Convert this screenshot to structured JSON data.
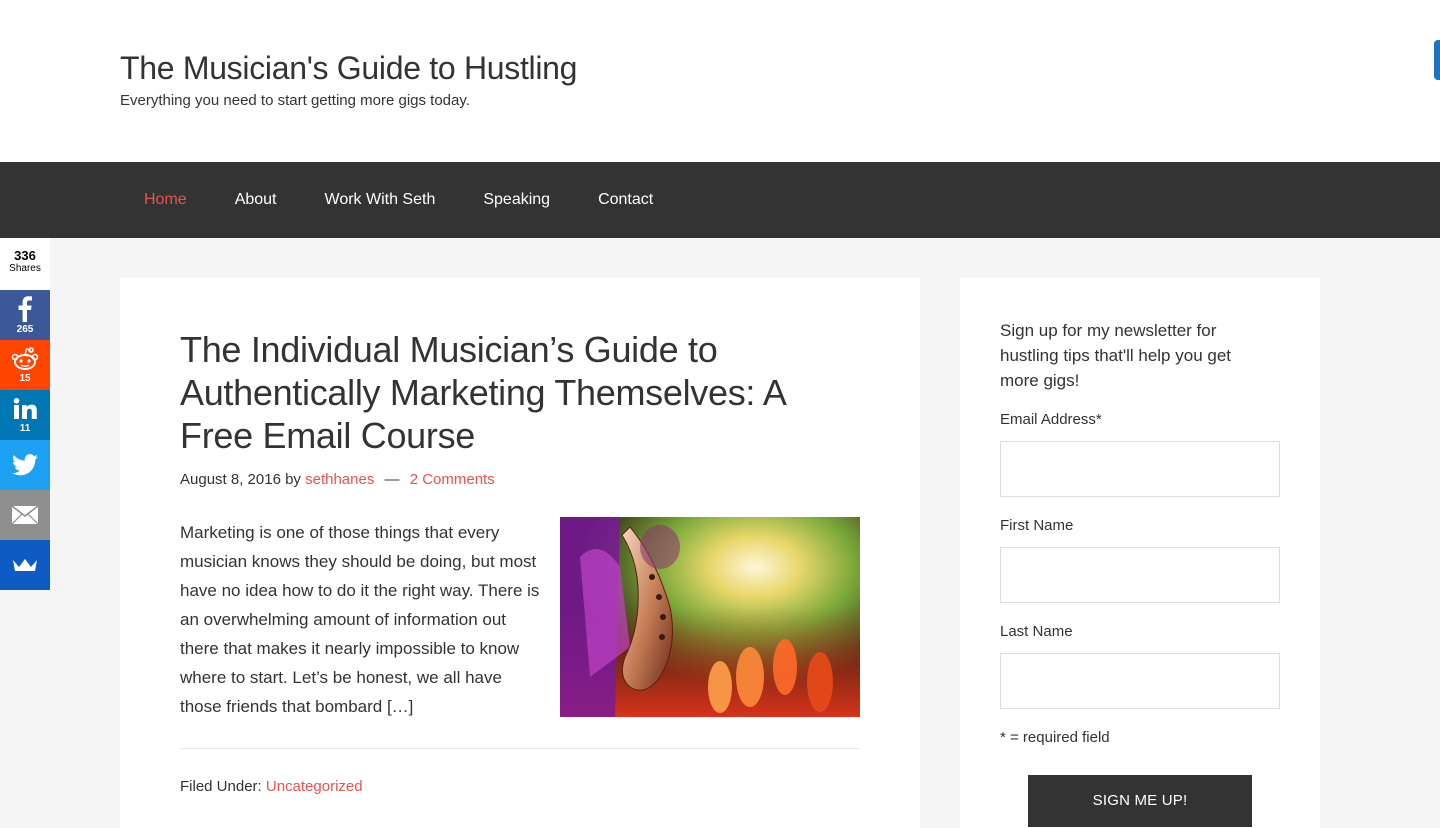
{
  "header": {
    "title": "The Musician's Guide to Hustling",
    "description": "Everything you need to start getting more gigs today."
  },
  "nav": {
    "items": [
      {
        "label": "Home",
        "active": true
      },
      {
        "label": "About"
      },
      {
        "label": "Work With Seth"
      },
      {
        "label": "Speaking"
      },
      {
        "label": "Contact"
      }
    ]
  },
  "share": {
    "total": "336",
    "total_label": "Shares",
    "facebook_count": "265",
    "reddit_count": "15",
    "linkedin_count": "11"
  },
  "post": {
    "title": "The Individual Musician’s Guide to Authentically Marketing Themselves: A Free Email Course",
    "date": "August 8, 2016",
    "by": "by",
    "author": "sethhanes",
    "separator": "—",
    "comments": "2 Comments",
    "excerpt": "Marketing is one of those things that every musician knows they should be doing, but most have no idea how to do it the right way. There is an overwhelming amount of information out there that makes it nearly impossible to know where to start. Let’s be honest, we all have those friends that bombard […]",
    "filed_label": "Filed Under:",
    "category": "Uncategorized"
  },
  "sidebar": {
    "heading": "Sign up for my newsletter for hustling tips that'll help you get more gigs!",
    "email_label": "Email Address*",
    "first_name_label": "First Name",
    "last_name_label": "Last Name",
    "required_note": "* = required field",
    "button_label": "SIGN ME UP!"
  },
  "colors": {
    "accent": "#e5554e",
    "nav_bg": "#333333",
    "facebook": "#3b5998",
    "reddit": "#ff4500",
    "linkedin": "#0077b5",
    "twitter": "#1da1f2",
    "email": "#8f8f8f",
    "sumome": "#0e5bc4"
  }
}
